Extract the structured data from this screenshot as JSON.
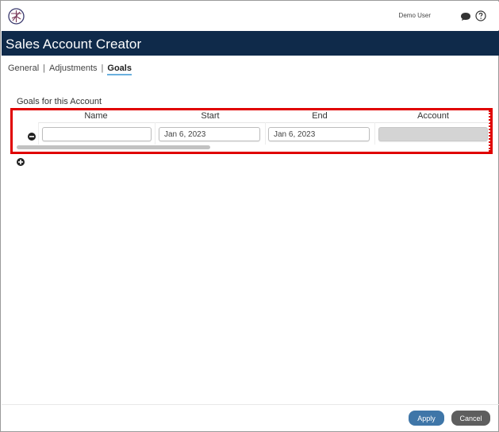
{
  "header": {
    "user_name": "Demo User",
    "logo_icon": "compass-logo-icon",
    "chat_icon": "chat-bubble-icon",
    "help_icon": "help-circle-icon"
  },
  "title": "Sales Account Creator",
  "tabs": [
    {
      "label": "General",
      "active": false
    },
    {
      "label": "Adjustments",
      "active": false
    },
    {
      "label": "Goals",
      "active": true
    }
  ],
  "goals": {
    "section_label": "Goals for this Account",
    "columns": [
      "Name",
      "Start",
      "End",
      "Account"
    ],
    "rows": [
      {
        "name": "",
        "start": "Jan 6, 2023",
        "end": "Jan 6, 2023",
        "account": ""
      }
    ],
    "remove_icon": "minus-circle-icon",
    "add_icon": "plus-circle-icon"
  },
  "footer": {
    "apply_label": "Apply",
    "cancel_label": "Cancel"
  },
  "colors": {
    "title_bar": "#0f2a4a",
    "highlight": "#e00000",
    "apply": "#3f76a8",
    "cancel": "#5e5e5e",
    "tab_underline": "#6ab0de"
  }
}
